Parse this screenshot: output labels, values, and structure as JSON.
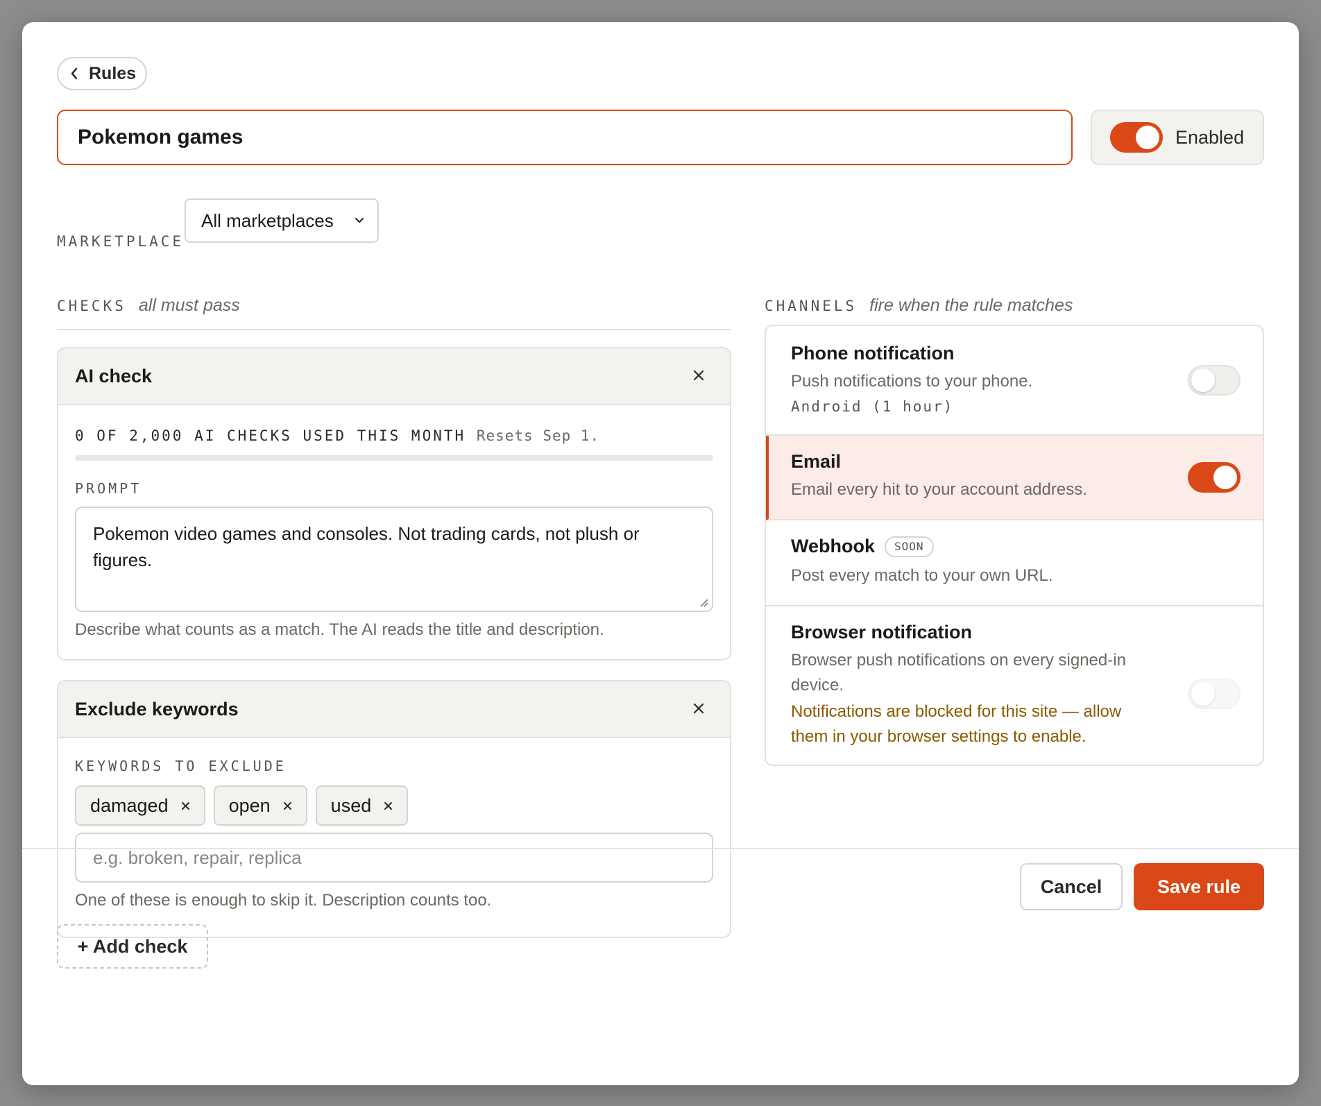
{
  "header": {
    "back_label": "Rules",
    "rule_name": "Pokemon games",
    "enabled_label": "Enabled",
    "enabled": true
  },
  "marketplace": {
    "label": "MARKETPLACE",
    "selected": "All marketplaces"
  },
  "checks": {
    "heading": "CHECKS",
    "hint": "all must pass",
    "ai_check": {
      "title": "AI check",
      "usage_text": "0 OF 2,000 AI CHECKS USED THIS MONTH",
      "resets_text": "Resets Sep 1.",
      "usage_used": 0,
      "usage_limit": 2000,
      "prompt_label": "PROMPT",
      "prompt_value": "Pokemon video games and consoles. Not trading cards, not plush or figures.",
      "helper": "Describe what counts as a match. The AI reads the title and description."
    },
    "exclude_keywords": {
      "title": "Exclude keywords",
      "label": "KEYWORDS TO EXCLUDE",
      "keywords": [
        "damaged",
        "open",
        "used"
      ],
      "placeholder": "e.g. broken, repair, replica",
      "helper": "One of these is enough to skip it. Description counts too."
    },
    "add_label": "+ Add check"
  },
  "channels": {
    "heading": "CHANNELS",
    "hint": "fire when the rule matches",
    "phone": {
      "title": "Phone notification",
      "desc": "Push notifications to your phone.",
      "sub": "Android (1 hour)",
      "enabled": false
    },
    "email": {
      "title": "Email",
      "desc": "Email every hit to your account address.",
      "enabled": true
    },
    "webhook": {
      "title": "Webhook",
      "badge": "SOON",
      "desc": "Post every match to your own URL."
    },
    "browser": {
      "title": "Browser notification",
      "desc": "Browser push notifications on every signed-in device.",
      "warning": "Notifications are blocked for this site — allow them in your browser settings to enable.",
      "enabled": false
    }
  },
  "footer": {
    "cancel_label": "Cancel",
    "save_label": "Save rule"
  },
  "colors": {
    "accent": "#d94816",
    "warning": "#8a5a00",
    "active_bg": "#fcebe6"
  }
}
